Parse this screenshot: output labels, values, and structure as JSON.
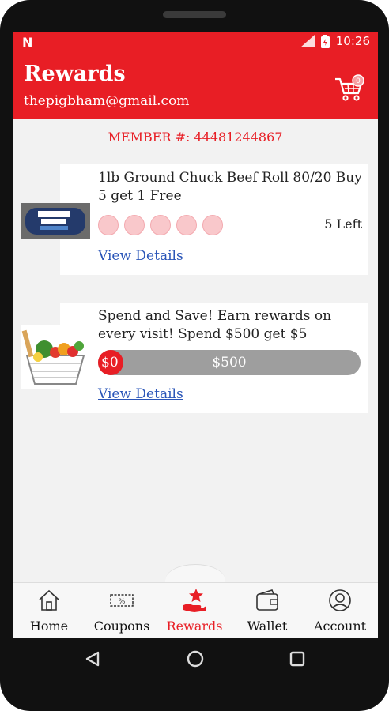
{
  "status": {
    "notification_icon": "N",
    "time": "10:26",
    "signal_icon": "signal-icon",
    "battery_icon": "battery-icon"
  },
  "appbar": {
    "title": "Rewards",
    "email": "thepigbham@gmail.com",
    "cart_icon": "cart-icon",
    "cart_count": "0"
  },
  "member": "MEMBER #: 44481244867",
  "rewards": [
    {
      "title": "1lb Ground Chuck Beef Roll 80/20 Buy 5 get 1 Free",
      "punches_total": 5,
      "punches_filled": 0,
      "left": "5 Left",
      "details": "View Details",
      "image": "ground-chuck-package-image"
    },
    {
      "title": "Spend and Save! Earn rewards on every visit! Spend $500 get $5",
      "progress_start": "$0",
      "progress_end": "$500",
      "progress_fraction": 0,
      "details": "View Details",
      "image": "grocery-basket-image"
    }
  ],
  "nav": {
    "home": "Home",
    "coupons": "Coupons",
    "rewards": "Rewards",
    "wallet": "Wallet",
    "account": "Account",
    "active": "rewards"
  },
  "colors": {
    "brand_red": "#e81e25",
    "punch_empty": "#f9c8cb",
    "link_blue": "#2a55b8",
    "progress_gray": "#9e9e9e"
  }
}
